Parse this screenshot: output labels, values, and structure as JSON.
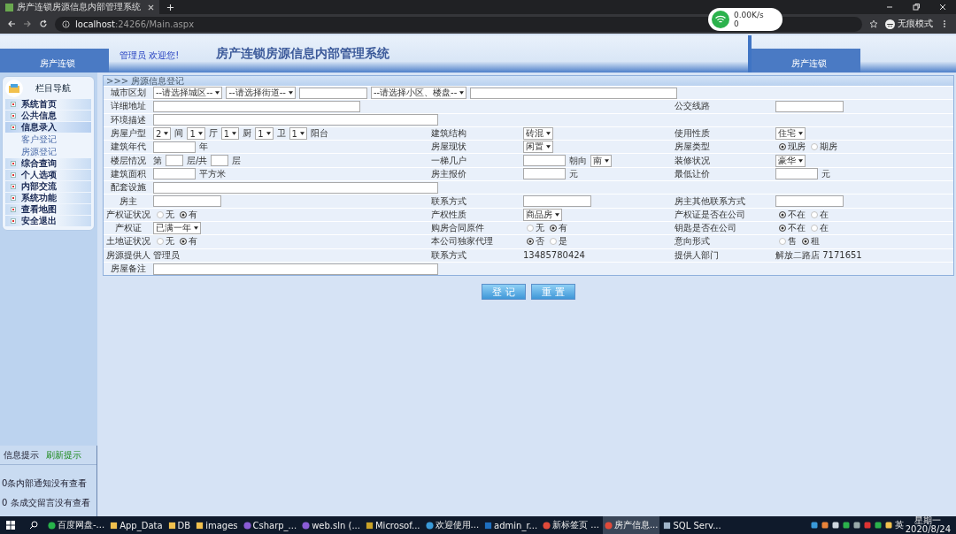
{
  "browser": {
    "tab_title": "房产连锁房源信息内部管理系统",
    "url_host": "localhost",
    "url_path": ":24266/Main.aspx",
    "profile": "无痕模式"
  },
  "network_widget": {
    "speed": "0.00K/s",
    "count": "0"
  },
  "banner": {
    "logo": "房产连锁",
    "greeting": "管理员 欢迎您!",
    "title": "房产连锁房源信息内部管理系统",
    "logo_repeat": "房产连锁"
  },
  "sidebar": {
    "heading": "栏目导航",
    "items": [
      {
        "label": "系统首页",
        "expanded": false
      },
      {
        "label": "公共信息",
        "expanded": false
      },
      {
        "label": "信息录入",
        "expanded": true,
        "children": [
          {
            "label": "客户登记"
          },
          {
            "label": "房源登记"
          }
        ]
      },
      {
        "label": "综合查询",
        "expanded": false
      },
      {
        "label": "个人选项",
        "expanded": false
      },
      {
        "label": "内部交流",
        "expanded": false
      },
      {
        "label": "系统功能",
        "expanded": false
      },
      {
        "label": "查看地图",
        "expanded": false
      },
      {
        "label": "安全退出",
        "expanded": false
      }
    ]
  },
  "message_panel": {
    "tabs": [
      {
        "label": "信息提示",
        "kind": "tab"
      },
      {
        "label": "刷新提示",
        "kind": "link"
      }
    ],
    "lines": [
      "0条内部通知没有查看",
      "0 条成交留言没有查看"
    ]
  },
  "form": {
    "title": ">>> 房源信息登记",
    "rows": [
      {
        "cells": [
          {
            "label": "城市区划",
            "fields": [
              {
                "kind": "select",
                "value": "--请选择城区--"
              },
              {
                "kind": "select",
                "value": "--请选择街道--"
              },
              {
                "kind": "input"
              },
              {
                "kind": "select",
                "value": "--请选择小区、楼盘--"
              },
              {
                "kind": "longinput"
              }
            ]
          }
        ]
      },
      {
        "cells": [
          {
            "label": "详细地址",
            "fields": [
              {
                "kind": "longinput"
              }
            ]
          },
          {},
          {
            "label": "公交线路",
            "fields": [
              {
                "kind": "input"
              }
            ]
          }
        ]
      },
      {
        "cells": [
          {
            "label": "环境描述",
            "fields": [
              {
                "kind": "wideinput"
              }
            ]
          }
        ]
      },
      {
        "cells": [
          {
            "label": "房屋户型",
            "fields": [
              {
                "kind": "select",
                "value": "2"
              },
              {
                "kind": "text",
                "text": "间"
              },
              {
                "kind": "select",
                "value": "1"
              },
              {
                "kind": "text",
                "text": "厅"
              },
              {
                "kind": "select",
                "value": "1"
              },
              {
                "kind": "text",
                "text": "厨"
              },
              {
                "kind": "select",
                "value": "1"
              },
              {
                "kind": "text",
                "text": "卫"
              },
              {
                "kind": "select",
                "value": "1"
              },
              {
                "kind": "text",
                "text": "阳台"
              }
            ]
          },
          {
            "label": "建筑结构",
            "fields": [
              {
                "kind": "select",
                "value": "砖混"
              }
            ]
          },
          {
            "label": "使用性质",
            "fields": [
              {
                "kind": "select",
                "value": "住宅"
              }
            ]
          }
        ]
      },
      {
        "cells": [
          {
            "label": "建筑年代",
            "fields": [
              {
                "kind": "shortinput"
              },
              {
                "kind": "text",
                "text": "年"
              }
            ]
          },
          {
            "label": "房屋现状",
            "fields": [
              {
                "kind": "select",
                "value": "闲置"
              }
            ]
          },
          {
            "label": "房屋类型",
            "fields": [
              {
                "kind": "radio",
                "options": [
                  {
                    "label": "现房",
                    "selected": true
                  },
                  {
                    "label": "期房",
                    "selected": false
                  }
                ]
              }
            ]
          }
        ]
      },
      {
        "cells": [
          {
            "label": "楼层情况",
            "fields": [
              {
                "kind": "text",
                "text": "第"
              },
              {
                "kind": "tinyinput"
              },
              {
                "kind": "text",
                "text": "层/共"
              },
              {
                "kind": "tinyinput"
              },
              {
                "kind": "text",
                "text": "层"
              }
            ]
          },
          {
            "label": "一梯几户",
            "fields": [
              {
                "kind": "shortinput"
              },
              {
                "kind": "text",
                "text": "朝向"
              },
              {
                "kind": "select",
                "value": "南"
              }
            ]
          },
          {
            "label": "装修状况",
            "fields": [
              {
                "kind": "select",
                "value": "豪华"
              }
            ]
          }
        ]
      },
      {
        "cells": [
          {
            "label": "建筑面积",
            "fields": [
              {
                "kind": "shortinput"
              },
              {
                "kind": "text",
                "text": "平方米"
              }
            ]
          },
          {
            "label": "房主报价",
            "fields": [
              {
                "kind": "shortinput"
              },
              {
                "kind": "text",
                "text": "元"
              }
            ]
          },
          {
            "label": "最低让价",
            "fields": [
              {
                "kind": "shortinput"
              },
              {
                "kind": "text",
                "text": "元"
              }
            ]
          }
        ]
      },
      {
        "cells": [
          {
            "label": "配套设施",
            "fields": [
              {
                "kind": "wideinput"
              }
            ]
          }
        ]
      },
      {
        "cells": [
          {
            "label": "房主",
            "fields": [
              {
                "kind": "input"
              }
            ]
          },
          {
            "label": "联系方式",
            "fields": [
              {
                "kind": "input"
              }
            ]
          },
          {
            "label": "房主其他联系方式",
            "fields": [
              {
                "kind": "input"
              }
            ]
          }
        ]
      },
      {
        "cells": [
          {
            "label": "产权证状况",
            "fields": [
              {
                "kind": "radio",
                "options": [
                  {
                    "label": "无",
                    "selected": false
                  },
                  {
                    "label": "有",
                    "selected": true
                  }
                ]
              }
            ]
          },
          {
            "label": "产权性质",
            "fields": [
              {
                "kind": "select",
                "value": "商品房"
              }
            ]
          },
          {
            "label": "产权证是否在公司",
            "fields": [
              {
                "kind": "radio",
                "options": [
                  {
                    "label": "不在",
                    "selected": true
                  },
                  {
                    "label": "在",
                    "selected": false
                  }
                ]
              }
            ]
          }
        ]
      },
      {
        "cells": [
          {
            "label": "产权证",
            "fields": [
              {
                "kind": "select",
                "value": "已满一年"
              }
            ]
          },
          {
            "label": "购房合同原件",
            "fields": [
              {
                "kind": "radio",
                "options": [
                  {
                    "label": "无",
                    "selected": false
                  },
                  {
                    "label": "有",
                    "selected": true
                  }
                ]
              }
            ]
          },
          {
            "label": "钥匙是否在公司",
            "fields": [
              {
                "kind": "radio",
                "options": [
                  {
                    "label": "不在",
                    "selected": true
                  },
                  {
                    "label": "在",
                    "selected": false
                  }
                ]
              }
            ]
          }
        ]
      },
      {
        "cells": [
          {
            "label": "土地证状况",
            "fields": [
              {
                "kind": "radio",
                "options": [
                  {
                    "label": "无",
                    "selected": false
                  },
                  {
                    "label": "有",
                    "selected": true
                  }
                ]
              }
            ]
          },
          {
            "label": "本公司独家代理",
            "fields": [
              {
                "kind": "radio",
                "options": [
                  {
                    "label": "否",
                    "selected": true
                  },
                  {
                    "label": "是",
                    "selected": false
                  }
                ]
              }
            ]
          },
          {
            "label": "意向形式",
            "fields": [
              {
                "kind": "radio",
                "options": [
                  {
                    "label": "售",
                    "selected": false
                  },
                  {
                    "label": "租",
                    "selected": true
                  }
                ]
              }
            ]
          }
        ]
      },
      {
        "cells": [
          {
            "label": "房源提供人",
            "fields": [
              {
                "kind": "text",
                "text": "管理员"
              }
            ]
          },
          {
            "label": "联系方式",
            "fields": [
              {
                "kind": "text",
                "text": "13485780424"
              }
            ]
          },
          {
            "label": "提供人部门",
            "fields": [
              {
                "kind": "text",
                "text": "解放二路店 7171651"
              }
            ]
          }
        ]
      },
      {
        "cells": [
          {
            "label": "房屋备注",
            "fields": [
              {
                "kind": "wideinput"
              }
            ]
          }
        ]
      }
    ]
  },
  "buttons": [
    "登 记",
    "重 置"
  ],
  "taskbar": {
    "items": [
      {
        "label": "百度网盘-...",
        "kind": "cloud",
        "selected": false
      },
      {
        "label": "App_Data",
        "kind": "folder",
        "selected": false
      },
      {
        "label": "DB",
        "kind": "folder",
        "selected": false
      },
      {
        "label": "images",
        "kind": "folder",
        "selected": false
      },
      {
        "label": "Csharp_...",
        "kind": "ide",
        "selected": false
      },
      {
        "label": "web.sln (...",
        "kind": "ide",
        "selected": false
      },
      {
        "label": "Microsof...",
        "kind": "tool",
        "selected": false
      },
      {
        "label": "欢迎使用...",
        "kind": "app",
        "selected": false
      },
      {
        "label": "admin_r...",
        "kind": "photo",
        "selected": false
      },
      {
        "label": "新标签页 ...",
        "kind": "browser",
        "selected": false
      },
      {
        "label": "房产信息...",
        "kind": "browser",
        "selected": true
      },
      {
        "label": "SQL Serv...",
        "kind": "db",
        "selected": false
      }
    ],
    "ime": "英",
    "weekday": "星期一",
    "date": "2020/8/24"
  }
}
